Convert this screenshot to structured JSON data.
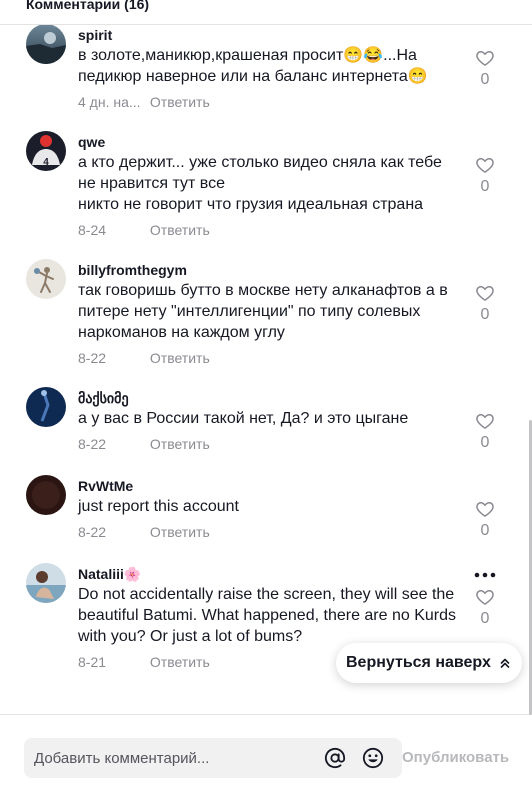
{
  "header": {
    "title": "Комментарии (16)"
  },
  "comments": [
    {
      "username": "spirit",
      "text": "в золоте,маникюр,крашеная просит😁😂...На педикюр наверное или на баланс интернета😁",
      "date": "4 дн. на...",
      "reply_label": "Ответить",
      "likes": "0"
    },
    {
      "username": "qwe",
      "text": "а кто держит... уже столько видео сняла как тебе не нравится тут все\nникто не говорит что грузия идеальная страна",
      "date": "8-24",
      "reply_label": "Ответить",
      "likes": "0"
    },
    {
      "username": "billyfromthegym",
      "text": "так говоришь бутто в москве нету алканафтов а в питере нету \"интеллигенции\" по типу солевых наркоманов на каждом углу",
      "date": "8-22",
      "reply_label": "Ответить",
      "likes": "0"
    },
    {
      "username": "მაქსიმე",
      "text": "а у вас в России такой нет, Да? и это цыгане",
      "date": "8-22",
      "reply_label": "Ответить",
      "likes": "0"
    },
    {
      "username": "RvWtMe",
      "text": "just report this account",
      "date": "8-22",
      "reply_label": "Ответить",
      "likes": "0"
    },
    {
      "username": "Nataliii🌸",
      "text": "Do not accidentally raise the screen, they will see the beautiful Batumi. What happened, there are no Kurds with you? Or just a lot of bums?",
      "date": "8-21",
      "reply_label": "Ответить",
      "likes": "0"
    }
  ],
  "back_to_top": {
    "label": "Вернуться наверх"
  },
  "footer": {
    "input_placeholder": "Добавить комментарий...",
    "publish_label": "Опубликовать"
  },
  "icons": {
    "like": "heart-outline-icon",
    "more": "more-dots-icon",
    "mention": "at-sign-icon",
    "emoji": "emoji-icon",
    "back_to_top": "double-chevron-up-icon"
  },
  "colors": {
    "text_primary": "#161823",
    "text_secondary": "#8a8b91",
    "input_bg": "#f1f1f2",
    "publish_disabled": "#b8b9bd"
  }
}
